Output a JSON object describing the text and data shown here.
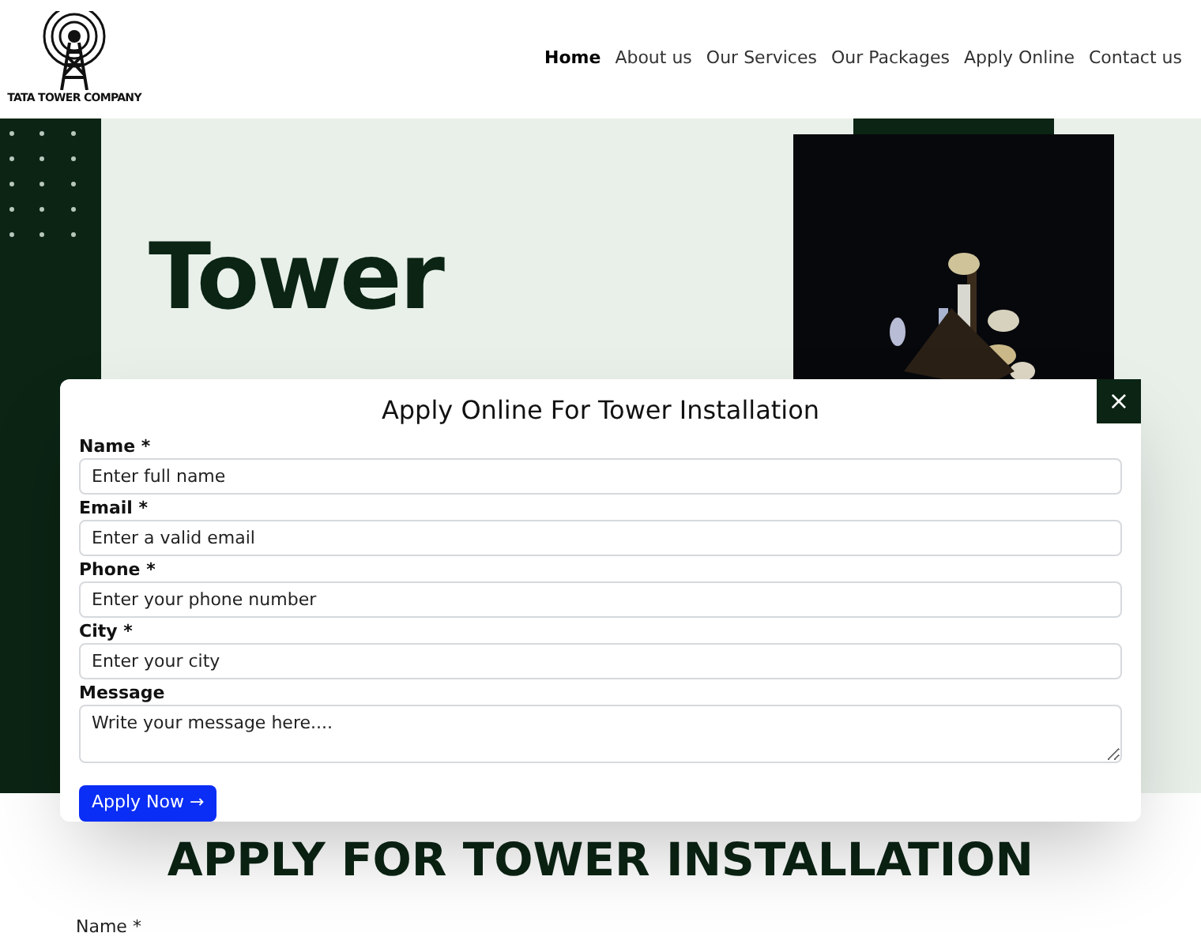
{
  "logo": {
    "text": "TATA TOWER COMPANY"
  },
  "nav": [
    {
      "label": "Home",
      "selected": true
    },
    {
      "label": "About us",
      "selected": false
    },
    {
      "label": "Our Services",
      "selected": false
    },
    {
      "label": "Our Packages",
      "selected": false
    },
    {
      "label": "Apply Online",
      "selected": false
    },
    {
      "label": "Contact us",
      "selected": false
    }
  ],
  "hero": {
    "title_lines": [
      "Tower"
    ],
    "kind": "picture"
  },
  "modal": {
    "title": "Apply Online For Tower Installation",
    "close": "×",
    "fields": [
      {
        "label": "Name *",
        "placeholder": "Enter full name",
        "kind": "input"
      },
      {
        "label": "Email *",
        "placeholder": "Enter a valid email",
        "kind": "input"
      },
      {
        "label": "Phone *",
        "placeholder": "Enter your phone number",
        "kind": "input"
      },
      {
        "label": "City *",
        "placeholder": "Enter your city",
        "kind": "input"
      },
      {
        "label": "Message",
        "placeholder": "Write your message here....",
        "kind": "textarea"
      }
    ],
    "submit": "Apply Now →"
  },
  "section": {
    "heading": "APPLY FOR TOWER INSTALLATION",
    "first_label": "Name *"
  }
}
